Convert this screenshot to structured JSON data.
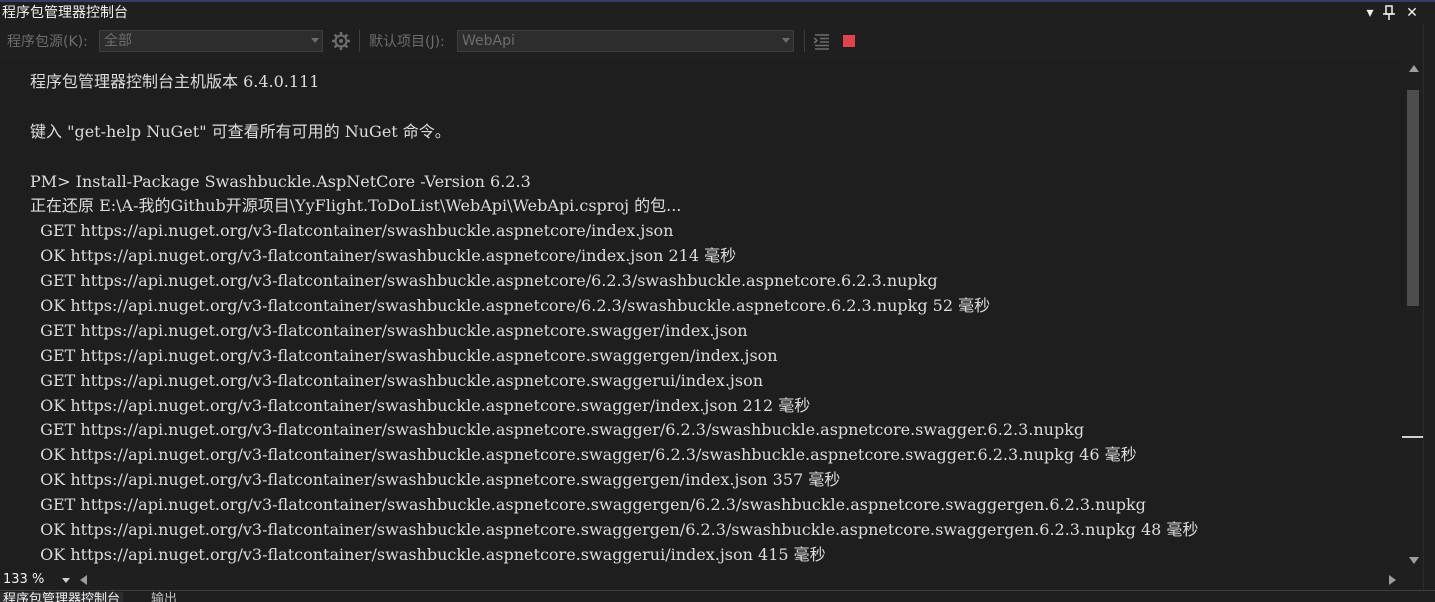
{
  "window": {
    "title": "程序包管理器控制台",
    "buttons": {
      "dropdown": "▾",
      "pin": "⊥",
      "close": "✕"
    }
  },
  "toolbar": {
    "source_label": "程序包源(K):",
    "source_value": "全部",
    "settings_icon": "gear-icon",
    "project_label": "默认项目(J):",
    "project_value": "WebApi",
    "clear_icon": "clear-console-icon",
    "stop_icon": "stop-icon",
    "stop_color": "#e0434e"
  },
  "console": {
    "lines": [
      "程序包管理器控制台主机版本 6.4.0.111",
      "",
      "键入 \"get-help NuGet\" 可查看所有可用的 NuGet 命令。",
      "",
      "PM> Install-Package Swashbuckle.AspNetCore -Version 6.2.3",
      "正在还原 E:\\A-我的Github开源项目\\YyFlight.ToDoList\\WebApi\\WebApi.csproj 的包...",
      "  GET https://api.nuget.org/v3-flatcontainer/swashbuckle.aspnetcore/index.json",
      "  OK https://api.nuget.org/v3-flatcontainer/swashbuckle.aspnetcore/index.json 214 毫秒",
      "  GET https://api.nuget.org/v3-flatcontainer/swashbuckle.aspnetcore/6.2.3/swashbuckle.aspnetcore.6.2.3.nupkg",
      "  OK https://api.nuget.org/v3-flatcontainer/swashbuckle.aspnetcore/6.2.3/swashbuckle.aspnetcore.6.2.3.nupkg 52 毫秒",
      "  GET https://api.nuget.org/v3-flatcontainer/swashbuckle.aspnetcore.swagger/index.json",
      "  GET https://api.nuget.org/v3-flatcontainer/swashbuckle.aspnetcore.swaggergen/index.json",
      "  GET https://api.nuget.org/v3-flatcontainer/swashbuckle.aspnetcore.swaggerui/index.json",
      "  OK https://api.nuget.org/v3-flatcontainer/swashbuckle.aspnetcore.swagger/index.json 212 毫秒",
      "  GET https://api.nuget.org/v3-flatcontainer/swashbuckle.aspnetcore.swagger/6.2.3/swashbuckle.aspnetcore.swagger.6.2.3.nupkg",
      "  OK https://api.nuget.org/v3-flatcontainer/swashbuckle.aspnetcore.swagger/6.2.3/swashbuckle.aspnetcore.swagger.6.2.3.nupkg 46 毫秒",
      "  OK https://api.nuget.org/v3-flatcontainer/swashbuckle.aspnetcore.swaggergen/index.json 357 毫秒",
      "  GET https://api.nuget.org/v3-flatcontainer/swashbuckle.aspnetcore.swaggergen/6.2.3/swashbuckle.aspnetcore.swaggergen.6.2.3.nupkg",
      "  OK https://api.nuget.org/v3-flatcontainer/swashbuckle.aspnetcore.swaggergen/6.2.3/swashbuckle.aspnetcore.swaggergen.6.2.3.nupkg 48 毫秒",
      "  OK https://api.nuget.org/v3-flatcontainer/swashbuckle.aspnetcore.swaggerui/index.json 415 毫秒"
    ]
  },
  "statusbar": {
    "zoom": "133 %"
  },
  "tabs": [
    {
      "label": "程序包管理器控制台",
      "active": true
    },
    {
      "label": "输出",
      "active": false
    }
  ]
}
